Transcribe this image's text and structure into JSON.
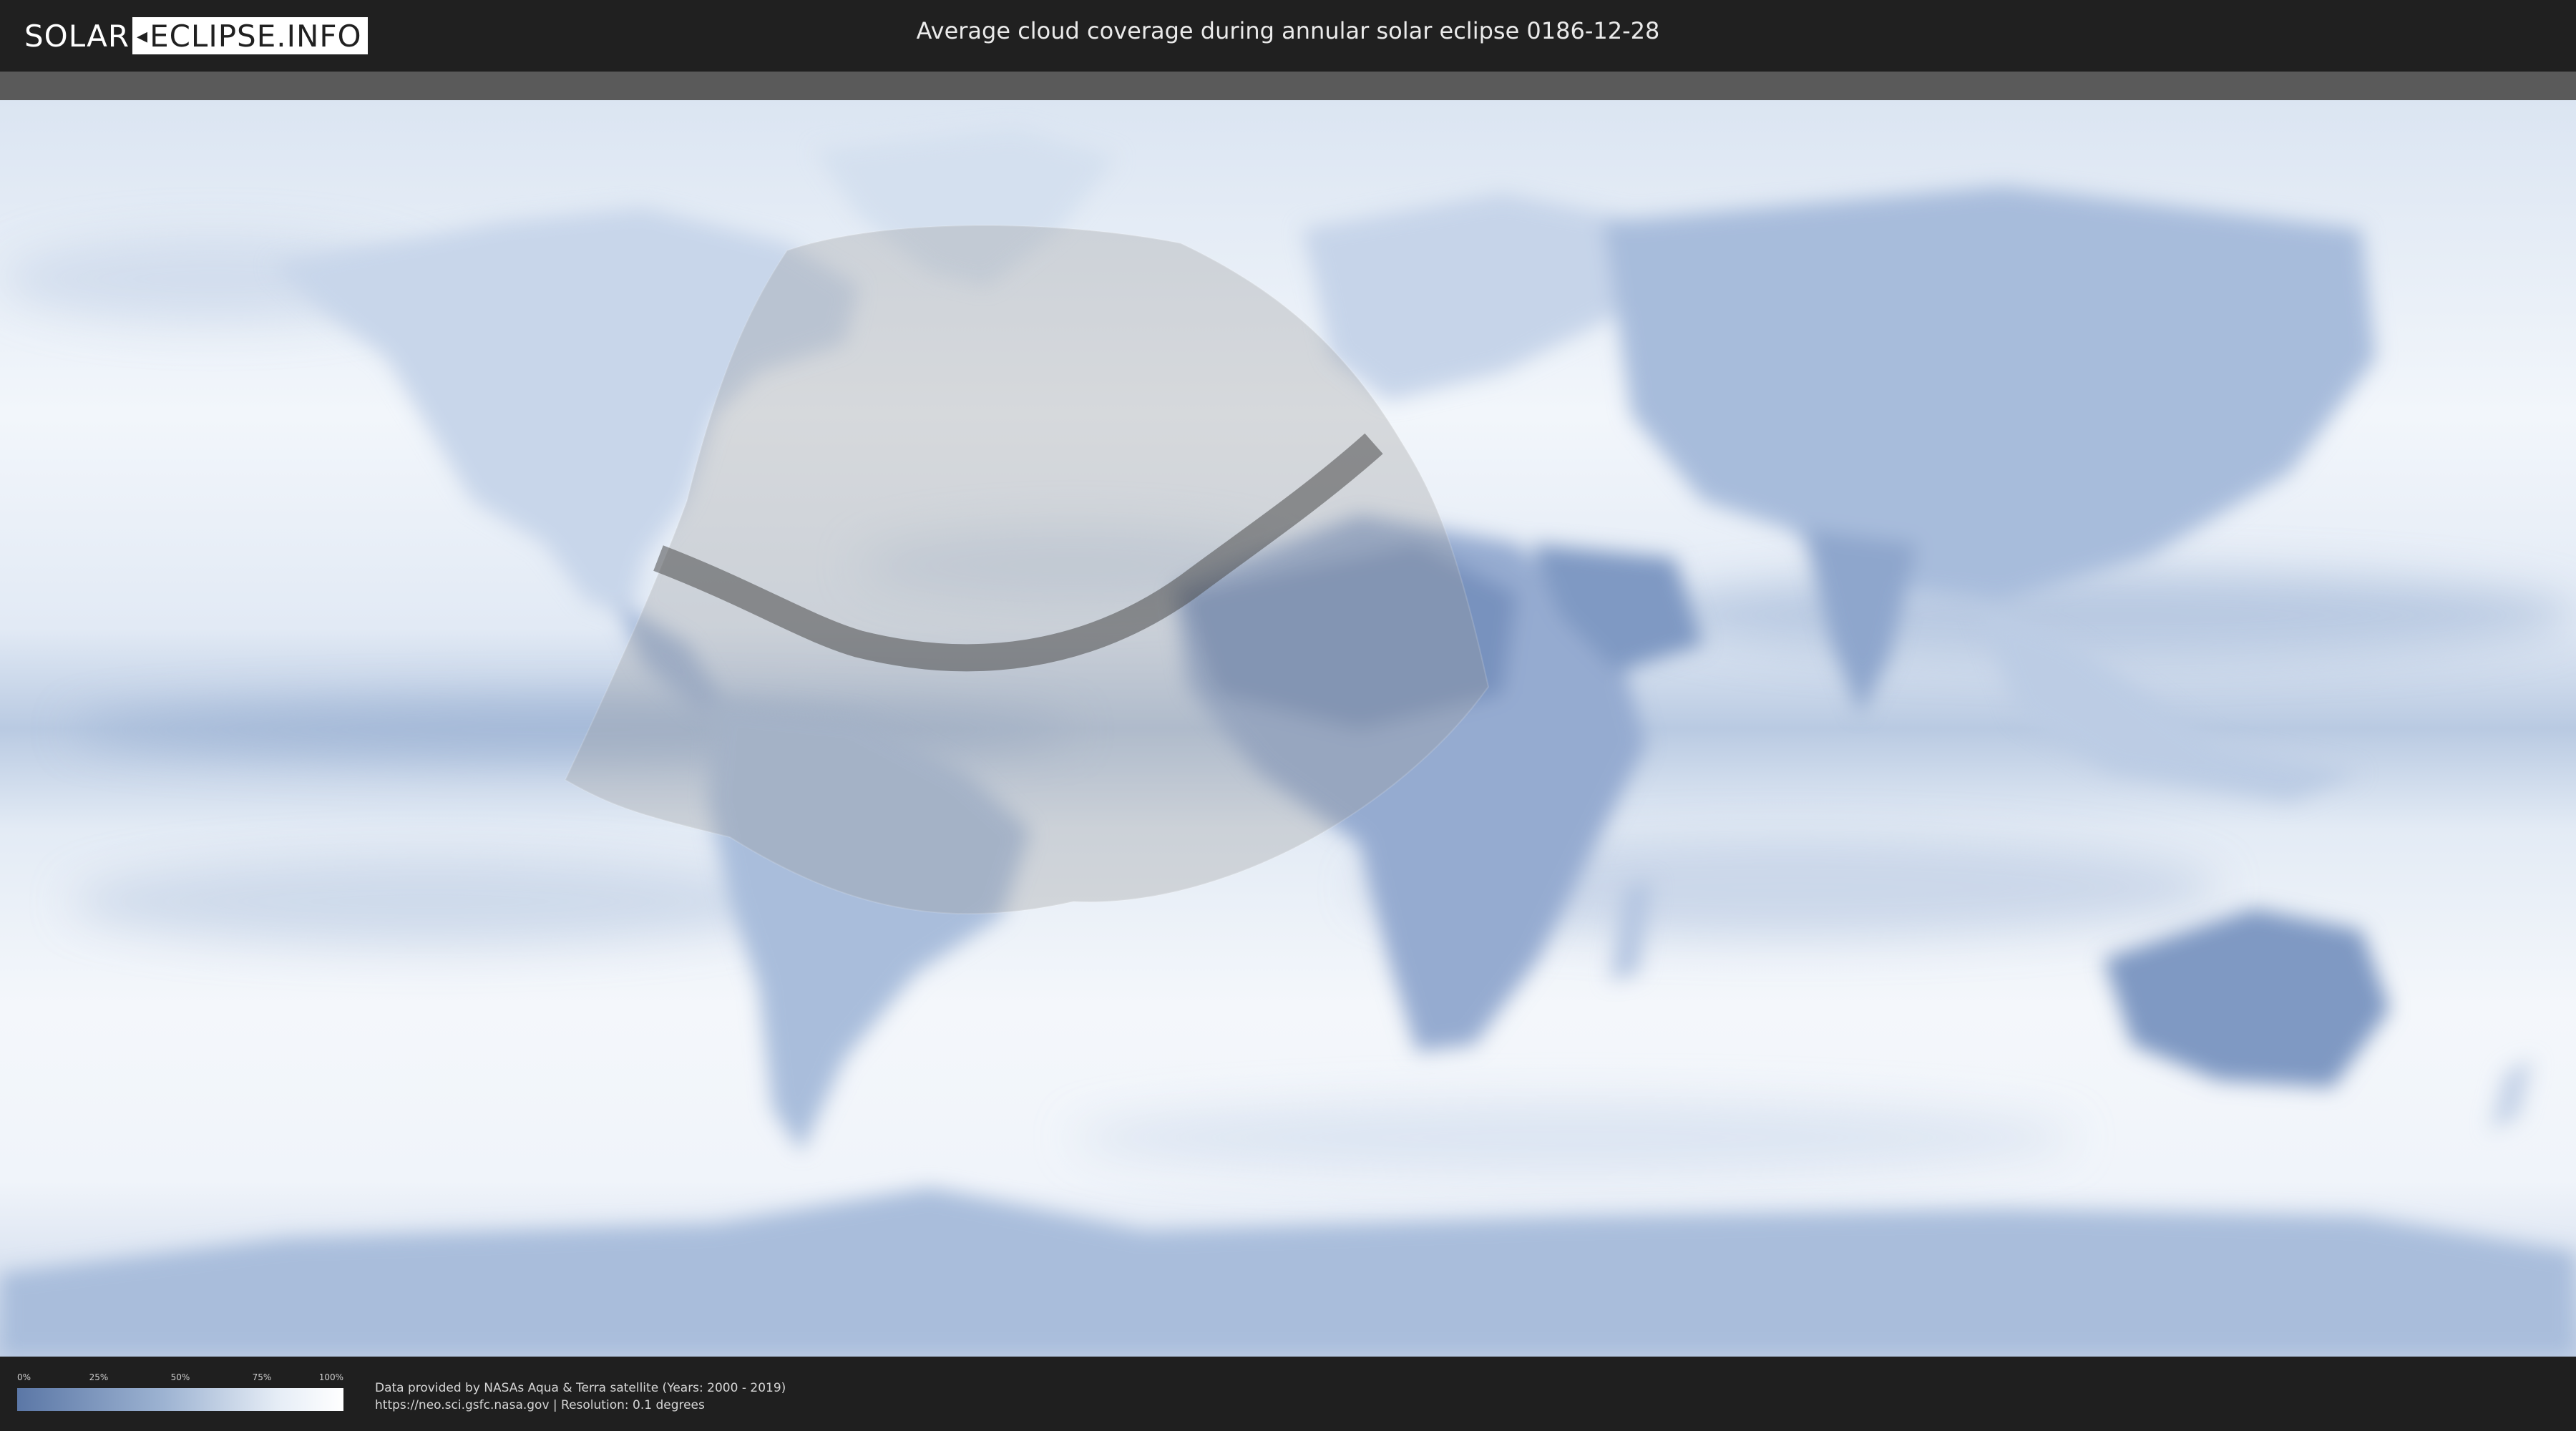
{
  "header": {
    "logo_part1": "SOLAR",
    "logo_part2": "ECLIPSE.INFO",
    "title": "Average cloud coverage during annular solar eclipse 0186-12-28"
  },
  "map": {
    "colors": {
      "cloud_light": "#f3f6fb",
      "cloud_blue": "#7f9bc6",
      "cloud_dark": "#5a76a8",
      "visibility_zone": "#9a9a9a",
      "eclipse_path": "#4d4d4d"
    }
  },
  "legend": {
    "ticks": [
      "0%",
      "25%",
      "50%",
      "75%",
      "100%"
    ],
    "fractions": [
      0,
      0.25,
      0.5,
      0.75,
      1
    ]
  },
  "credits": {
    "line1": "Data provided by NASAs Aqua & Terra satellite (Years: 2000 - 2019)",
    "line2": "https://neo.sci.gsfc.nasa.gov | Resolution: 0.1 degrees"
  }
}
